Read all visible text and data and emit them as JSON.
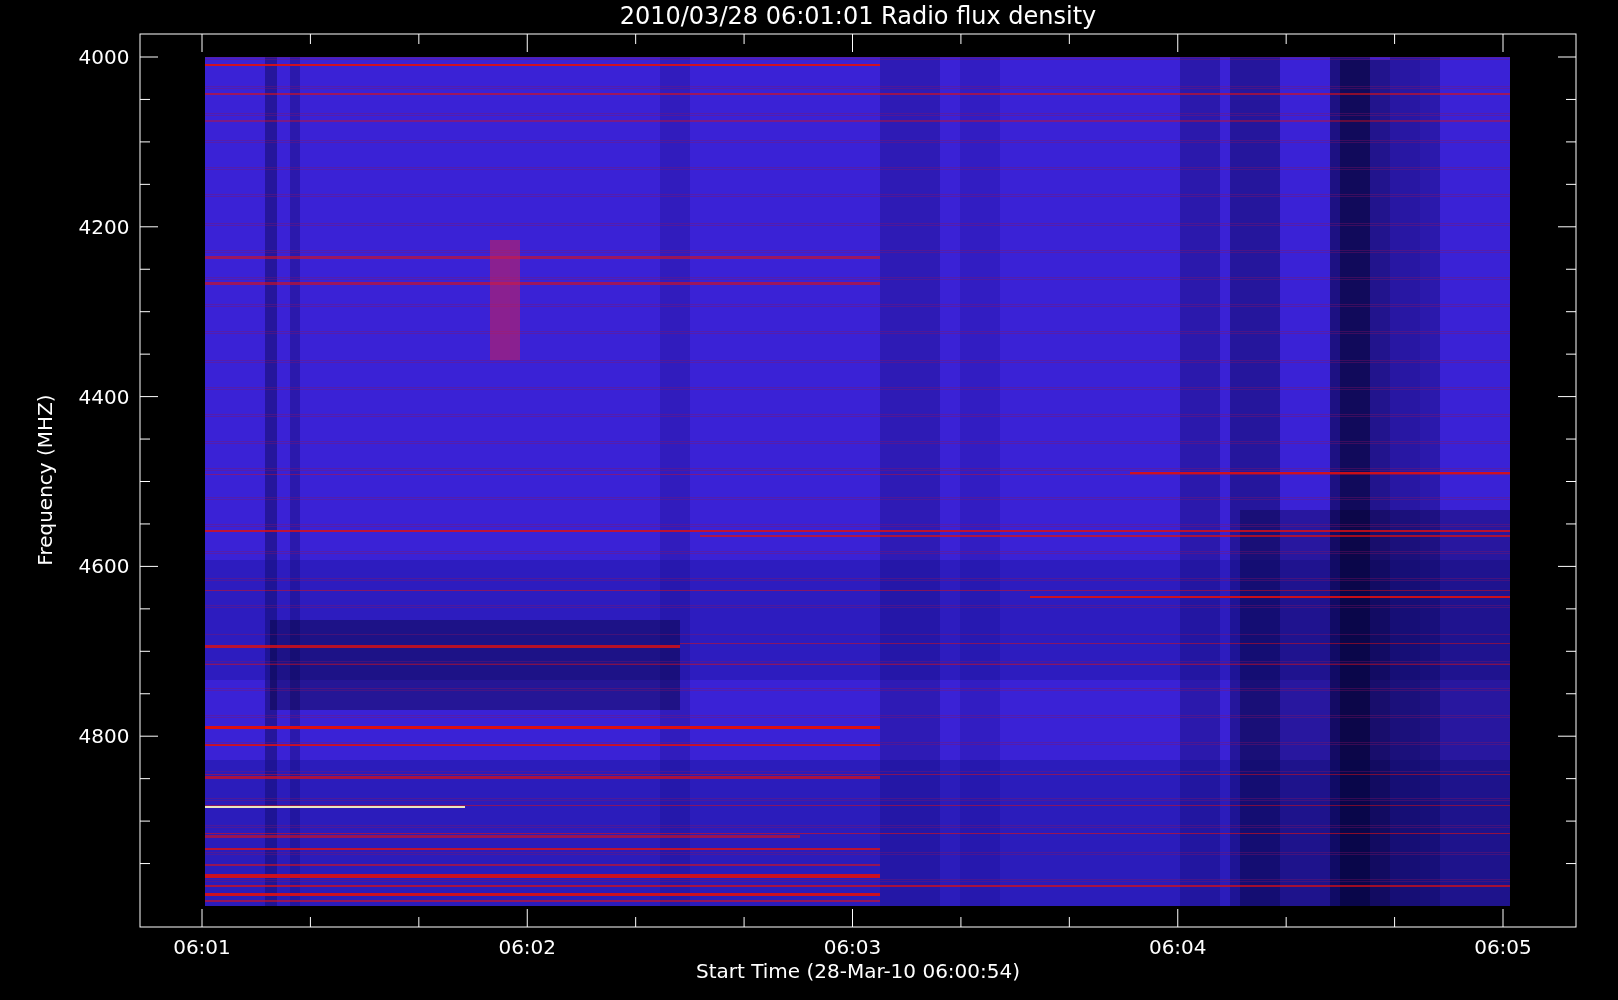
{
  "title": "2010/03/28 06:01:01 Radio flux density",
  "ylabel": "Frequency (MHZ)",
  "xlabel": "Start Time (28-Mar-10 06:00:54)",
  "yticks": [
    "4000",
    "4200",
    "4400",
    "4600",
    "4800"
  ],
  "xticks": [
    "06:01",
    "06:02",
    "06:03",
    "06:04",
    "06:05"
  ]
}
